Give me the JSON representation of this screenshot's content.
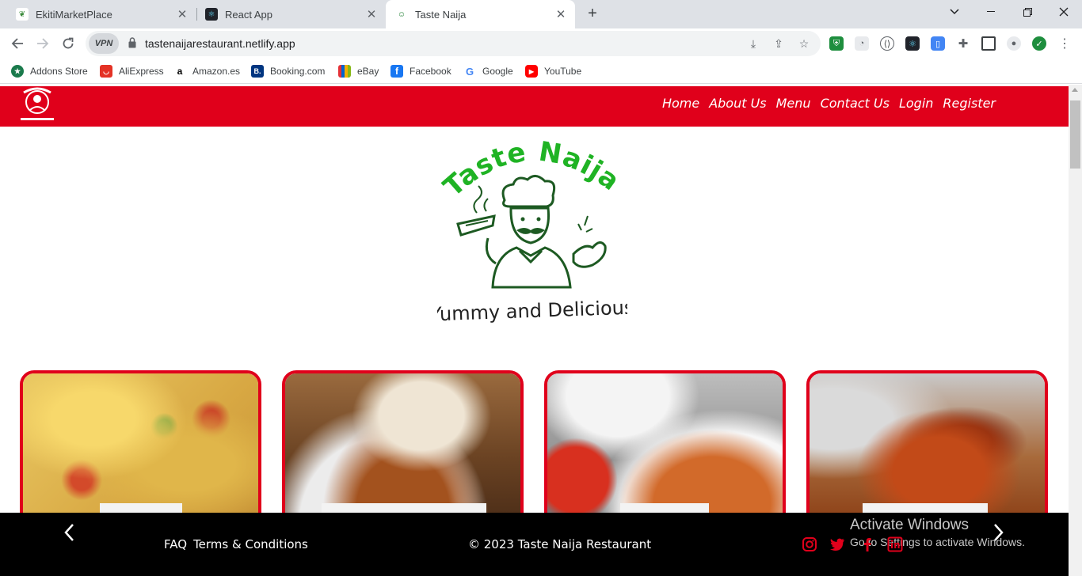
{
  "browser": {
    "tabs": [
      {
        "title": "EkitiMarketPlace",
        "active": false,
        "icon": "leaf-icon"
      },
      {
        "title": "React App",
        "active": false,
        "icon": "react-icon"
      },
      {
        "title": "Taste Naija",
        "active": true,
        "icon": "taste-naija-icon"
      }
    ],
    "vpn_label": "VPN",
    "url": "tastenaijarestaurant.netlify.app",
    "bookmarks": [
      {
        "label": "Addons Store",
        "color": "#1a7a4c"
      },
      {
        "label": "AliExpress",
        "color": "#e43225"
      },
      {
        "label": "Amazon.es",
        "color": "#000000"
      },
      {
        "label": "Booking.com",
        "color": "#003580"
      },
      {
        "label": "eBay",
        "color": "#3665f3"
      },
      {
        "label": "Facebook",
        "color": "#1877f2"
      },
      {
        "label": "Google",
        "color": "#4285f4"
      },
      {
        "label": "YouTube",
        "color": "#ff0000"
      }
    ]
  },
  "site": {
    "brand_color": "#e0001b",
    "nav": [
      {
        "label": "Home"
      },
      {
        "label": "About Us"
      },
      {
        "label": "Menu"
      },
      {
        "label": "Contact Us"
      },
      {
        "label": "Login"
      },
      {
        "label": "Register"
      }
    ],
    "hero": {
      "brand_name": "Taste Naija",
      "tagline": "Yummy and Delicious"
    },
    "footer": {
      "faq": "FAQ",
      "terms": "Terms & Conditions",
      "copyright": "© 2023 Taste Naija Restaurant",
      "social_icons": [
        "instagram-icon",
        "twitter-icon",
        "facebook-icon",
        "linkedin-icon"
      ]
    }
  },
  "windows_watermark": {
    "line1": "Activate Windows",
    "line2": "Go to Settings to activate Windows."
  }
}
